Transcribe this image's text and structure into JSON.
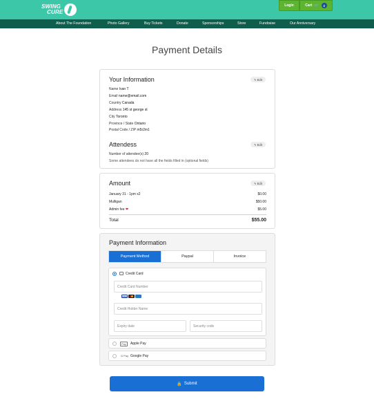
{
  "header": {
    "logo": {
      "line1": "SWING",
      "line2": "CURE"
    },
    "login_label": "Login",
    "cart_label": "Cart",
    "cart_count": "2"
  },
  "nav": [
    {
      "label": "About The Foundation",
      "name": "nav-about"
    },
    {
      "label": "Photo Gallery",
      "name": "nav-photo-gallery"
    },
    {
      "label": "Buy Tickets",
      "name": "nav-buy-tickets"
    },
    {
      "label": "Donate",
      "name": "nav-donate"
    },
    {
      "label": "Sponsorships",
      "name": "nav-sponsorships"
    },
    {
      "label": "Store",
      "name": "nav-store"
    },
    {
      "label": "Fundraise",
      "name": "nav-fundraise"
    },
    {
      "label": "Our Anniversary",
      "name": "nav-anniversary"
    }
  ],
  "page_title": "Payment Details",
  "your_info": {
    "title": "Your Information",
    "edit_label": "Edit",
    "fields": [
      {
        "label": "Name",
        "value": "Ivan T"
      },
      {
        "label": "Email",
        "value": "name@email.com"
      },
      {
        "label": "Country",
        "value": "Canada"
      },
      {
        "label": "Address",
        "value": "145 st george st"
      },
      {
        "label": "City",
        "value": "Toronto"
      },
      {
        "label": "Province / State",
        "value": "Ontario"
      },
      {
        "label": "Postal Code / ZIP",
        "value": "m5r2m1"
      }
    ]
  },
  "attendees": {
    "title": "Attendess",
    "edit_label": "Edit",
    "count_label": "Number of attendee(s)",
    "count_value": "20",
    "note": "Some attendees do not have all the fields filled in (optional fields)"
  },
  "amount": {
    "title": "Amount",
    "edit_label": "Edit",
    "items": [
      {
        "label": "January 31 - 1pm x2",
        "value": "$0.00"
      },
      {
        "label": "Mulligan",
        "value": "$50.00"
      },
      {
        "label": "Admin fee",
        "value": "$5.00"
      }
    ],
    "total_label": "Total",
    "total_value": "$55.00"
  },
  "payment": {
    "title": "Payment Information",
    "tabs": [
      "Payment Method",
      "Paypal",
      "Invoice"
    ],
    "credit_card_label": "Credit Card",
    "card_number_placeholder": "Credit Card Number",
    "holder_placeholder": "Credit Holder Name",
    "expiry_placeholder": "Expiry date",
    "security_placeholder": "Security code",
    "visa_text": "VISA",
    "apple_pay_label": "Apple Pay",
    "apple_pay_icon_text": "Pay",
    "google_pay_label": "Google Pay",
    "google_pay_icon_text": "G Pay"
  },
  "submit_label": "Submit",
  "colors": {
    "header_bg": "#3cc7a8",
    "nav_bg": "#0f5e4d",
    "button_green": "#5cb531",
    "primary_blue": "#1a6fd4"
  }
}
